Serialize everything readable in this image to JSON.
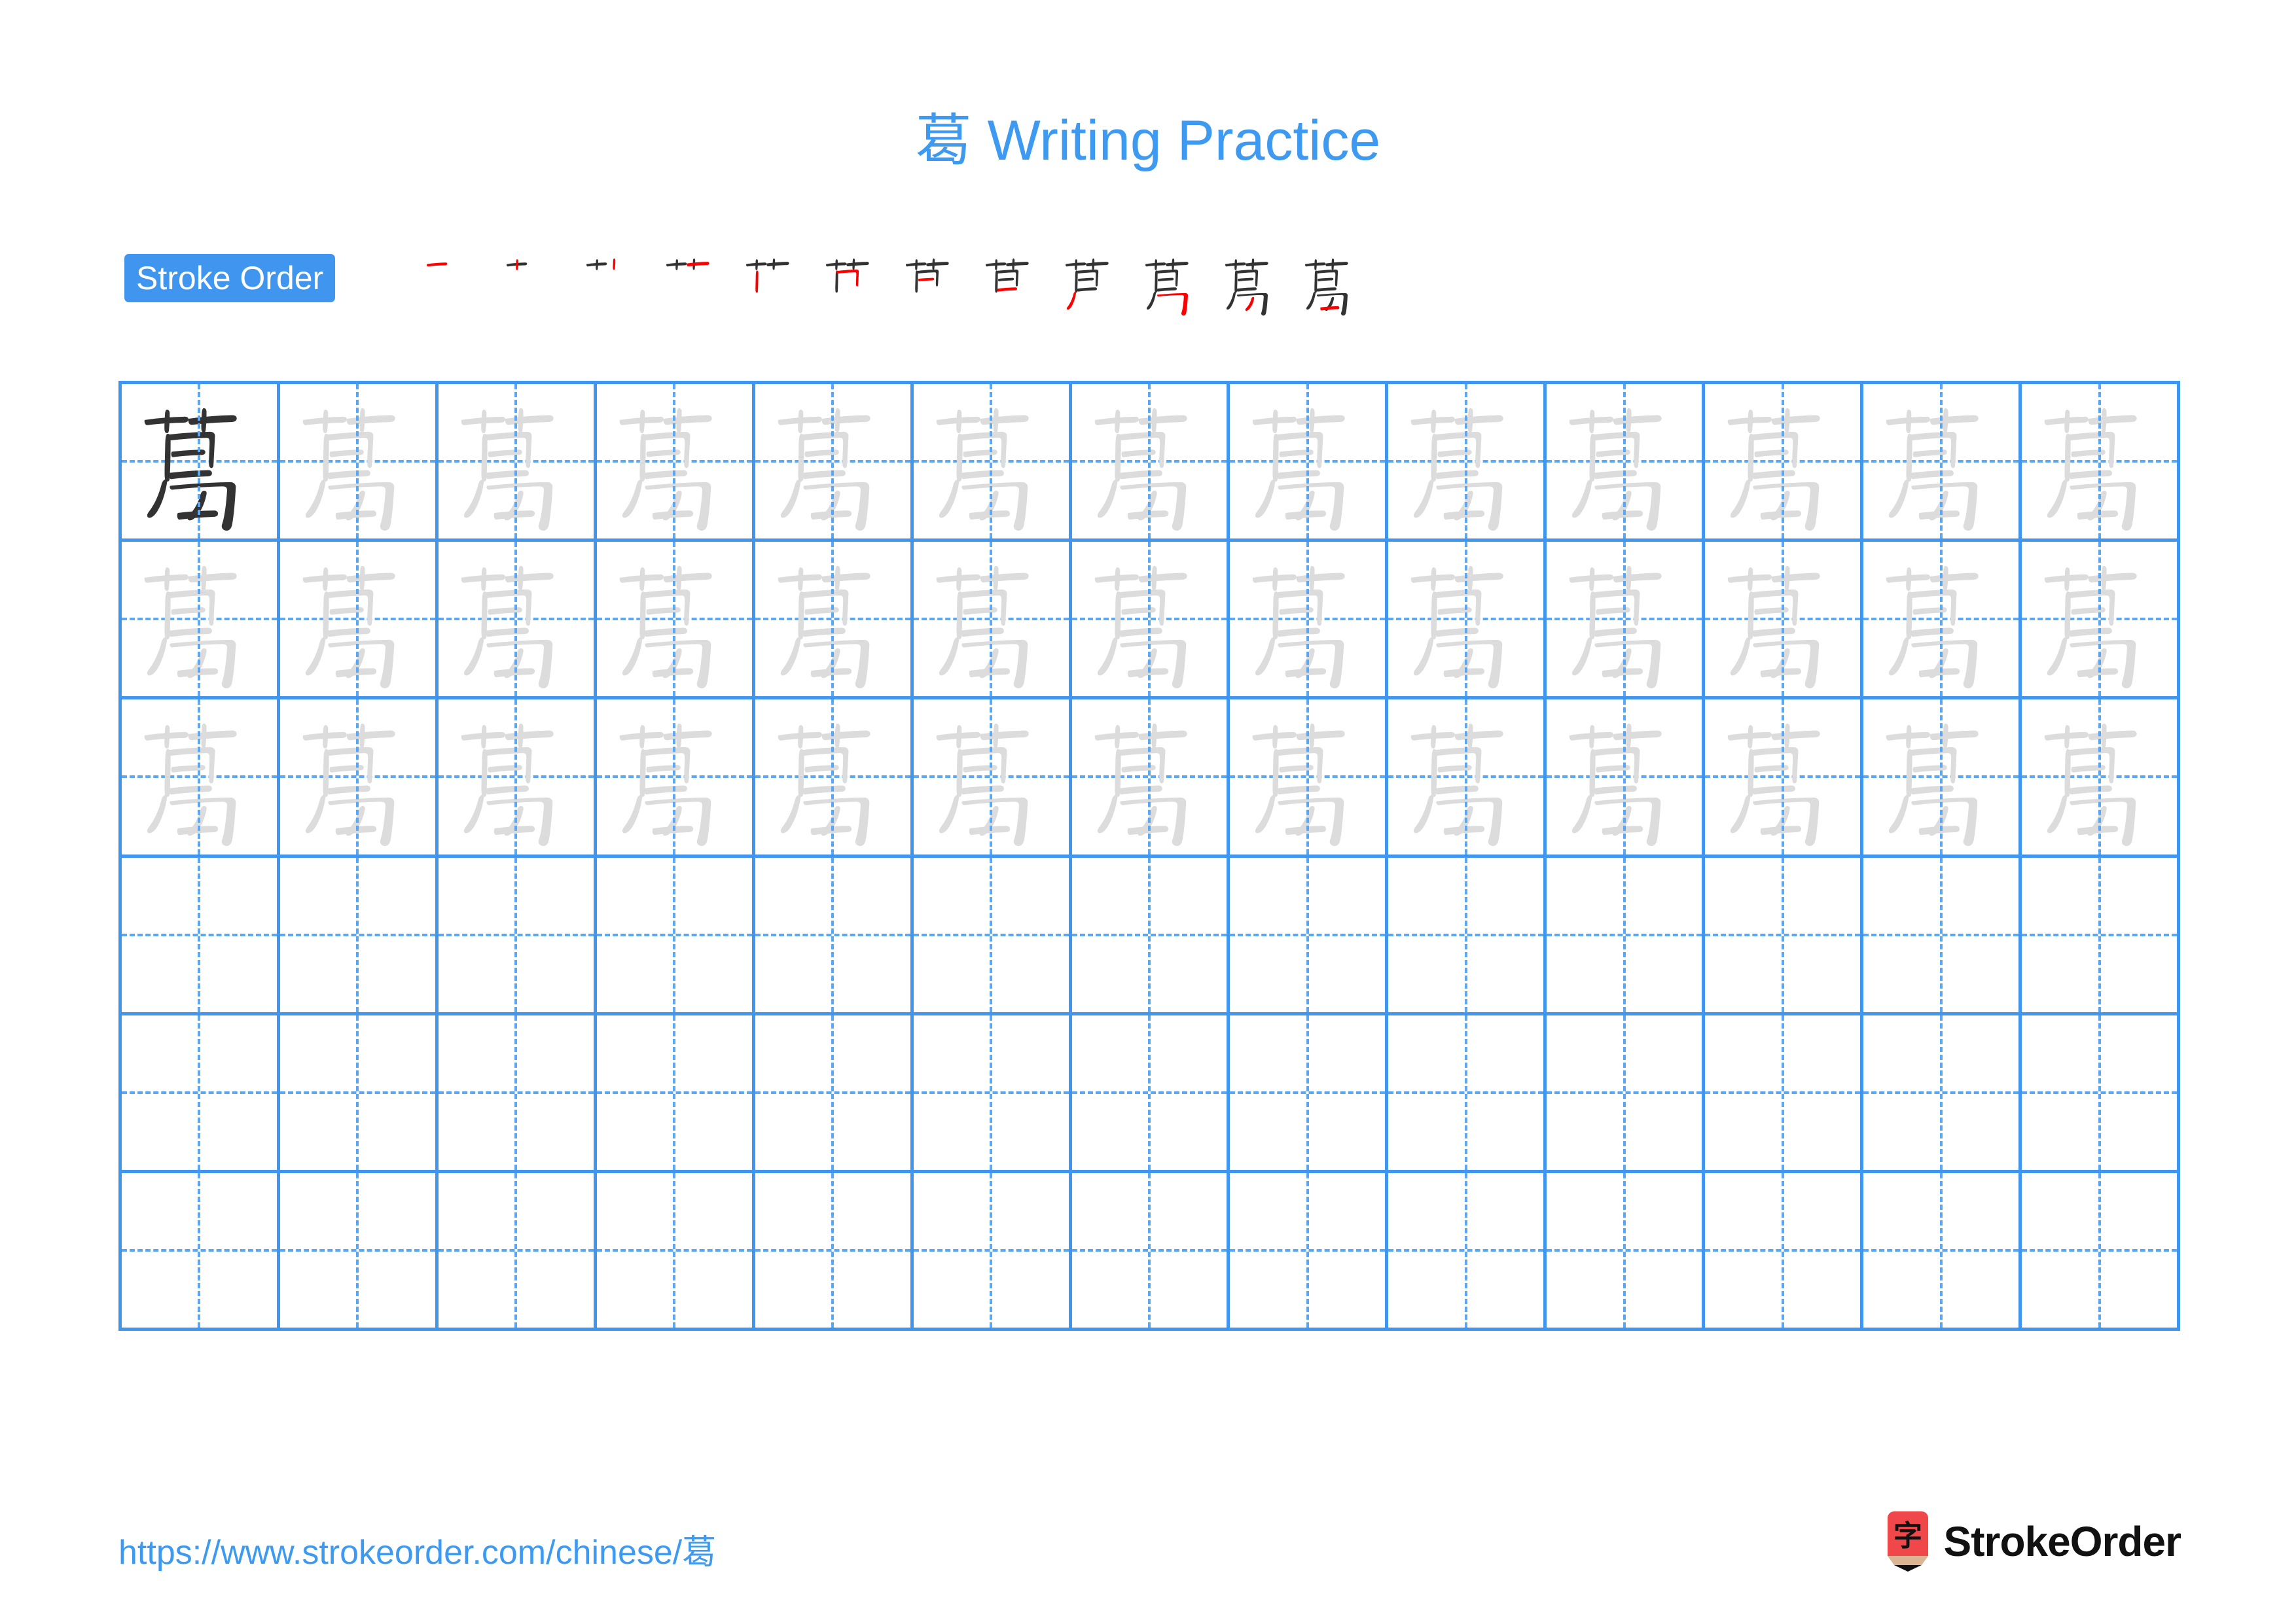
{
  "page": {
    "character": "葛",
    "title": "葛 Writing Practice",
    "accent_color": "#3d9af0",
    "badge_color": "#4096ee",
    "grid_line_color": "#4096ee",
    "guide_line_color": "#5ba7f2",
    "model_char_color": "#333333",
    "trace_char_color": "#dcdcdc",
    "new_stroke_color": "#ff0000",
    "existing_stroke_color": "#333333"
  },
  "stroke_order": {
    "badge_label": "Stroke Order",
    "total_strokes": 12,
    "steps": [
      {
        "index": 1,
        "glyph": "一",
        "new_stroke": "heng"
      },
      {
        "index": 2,
        "glyph": "十",
        "new_stroke": "shu"
      },
      {
        "index": 3,
        "glyph": "卄",
        "new_stroke": "shu"
      },
      {
        "index": 4,
        "glyph": "艹",
        "new_stroke": "shu"
      },
      {
        "index": 5,
        "glyph": "艼",
        "new_stroke": "shu-gou"
      },
      {
        "index": 6,
        "glyph": "苎",
        "new_stroke": "heng"
      },
      {
        "index": 7,
        "glyph": "苫",
        "new_stroke": "heng"
      },
      {
        "index": 8,
        "glyph": "芦",
        "new_stroke": "pie"
      },
      {
        "index": 9,
        "glyph": "茑",
        "new_stroke": "heng-zhe-gou"
      },
      {
        "index": 10,
        "glyph": "莴",
        "new_stroke": "pie"
      },
      {
        "index": 11,
        "glyph": "葛",
        "new_stroke": "pie"
      },
      {
        "index": 12,
        "glyph": "葛",
        "new_stroke": "heng"
      }
    ]
  },
  "practice_grid": {
    "columns": 13,
    "rows": 6,
    "cells": [
      [
        "model",
        "trace",
        "trace",
        "trace",
        "trace",
        "trace",
        "trace",
        "trace",
        "trace",
        "trace",
        "trace",
        "trace",
        "trace"
      ],
      [
        "trace",
        "trace",
        "trace",
        "trace",
        "trace",
        "trace",
        "trace",
        "trace",
        "trace",
        "trace",
        "trace",
        "trace",
        "trace"
      ],
      [
        "trace",
        "trace",
        "trace",
        "trace",
        "trace",
        "trace",
        "trace",
        "trace",
        "trace",
        "trace",
        "trace",
        "trace",
        "trace"
      ],
      [
        "empty",
        "empty",
        "empty",
        "empty",
        "empty",
        "empty",
        "empty",
        "empty",
        "empty",
        "empty",
        "empty",
        "empty",
        "empty"
      ],
      [
        "empty",
        "empty",
        "empty",
        "empty",
        "empty",
        "empty",
        "empty",
        "empty",
        "empty",
        "empty",
        "empty",
        "empty",
        "empty"
      ],
      [
        "empty",
        "empty",
        "empty",
        "empty",
        "empty",
        "empty",
        "empty",
        "empty",
        "empty",
        "empty",
        "empty",
        "empty",
        "empty"
      ]
    ]
  },
  "footer": {
    "url": "https://www.strokeorder.com/chinese/葛",
    "logo_text": "StrokeOrder",
    "logo_char": "字",
    "logo_body_color": "#f0484a",
    "logo_wood_color": "#dbb494",
    "logo_tip_color": "#111111"
  }
}
